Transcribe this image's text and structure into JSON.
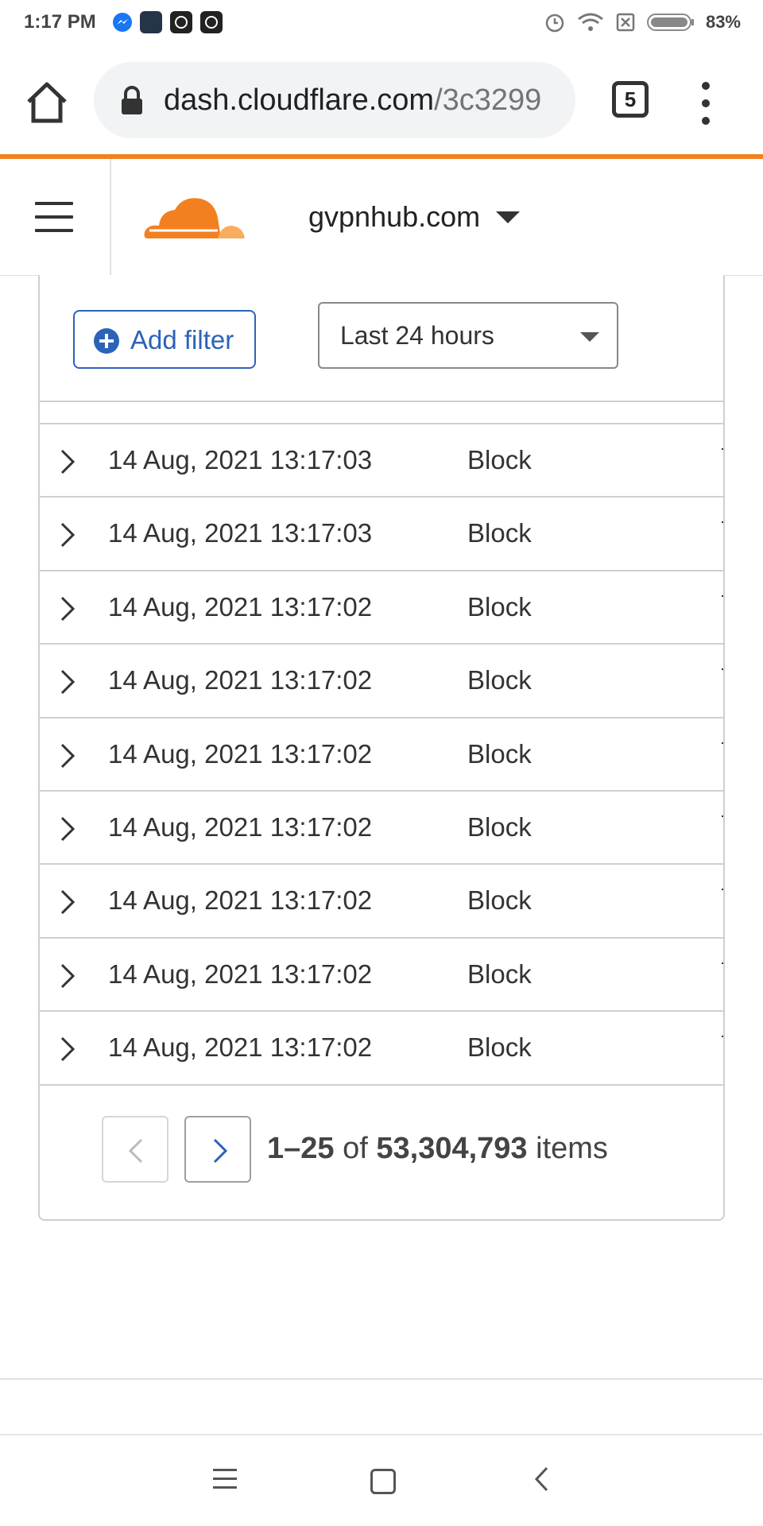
{
  "status_bar": {
    "time": "1:17 PM",
    "battery": "83%",
    "icons": [
      "messenger-icon",
      "game-app-icon",
      "chatgpt-like-app-icon",
      "chatgpt-like-app-icon",
      "alarm-icon",
      "wifi-icon",
      "no-sim-icon",
      "battery-icon"
    ]
  },
  "browser": {
    "url_host": "dash.cloudflare.com",
    "url_path": "/3c3299",
    "tab_count": "5",
    "accent_color": "#f38020"
  },
  "header": {
    "domain": "gvpnhub.com"
  },
  "toolbar": {
    "add_filter_label": "Add filter",
    "time_range": "Last 24 hours"
  },
  "events": [
    {
      "timestamp": "14 Aug, 2021 13:17:03",
      "action": "Block"
    },
    {
      "timestamp": "14 Aug, 2021 13:17:03",
      "action": "Block"
    },
    {
      "timestamp": "14 Aug, 2021 13:17:02",
      "action": "Block"
    },
    {
      "timestamp": "14 Aug, 2021 13:17:02",
      "action": "Block"
    },
    {
      "timestamp": "14 Aug, 2021 13:17:02",
      "action": "Block"
    },
    {
      "timestamp": "14 Aug, 2021 13:17:02",
      "action": "Block"
    },
    {
      "timestamp": "14 Aug, 2021 13:17:02",
      "action": "Block"
    },
    {
      "timestamp": "14 Aug, 2021 13:17:02",
      "action": "Block"
    },
    {
      "timestamp": "14 Aug, 2021 13:17:02",
      "action": "Block"
    }
  ],
  "pagination": {
    "range": "1–25",
    "of": "of",
    "total": "53,304,793",
    "items": "items"
  }
}
